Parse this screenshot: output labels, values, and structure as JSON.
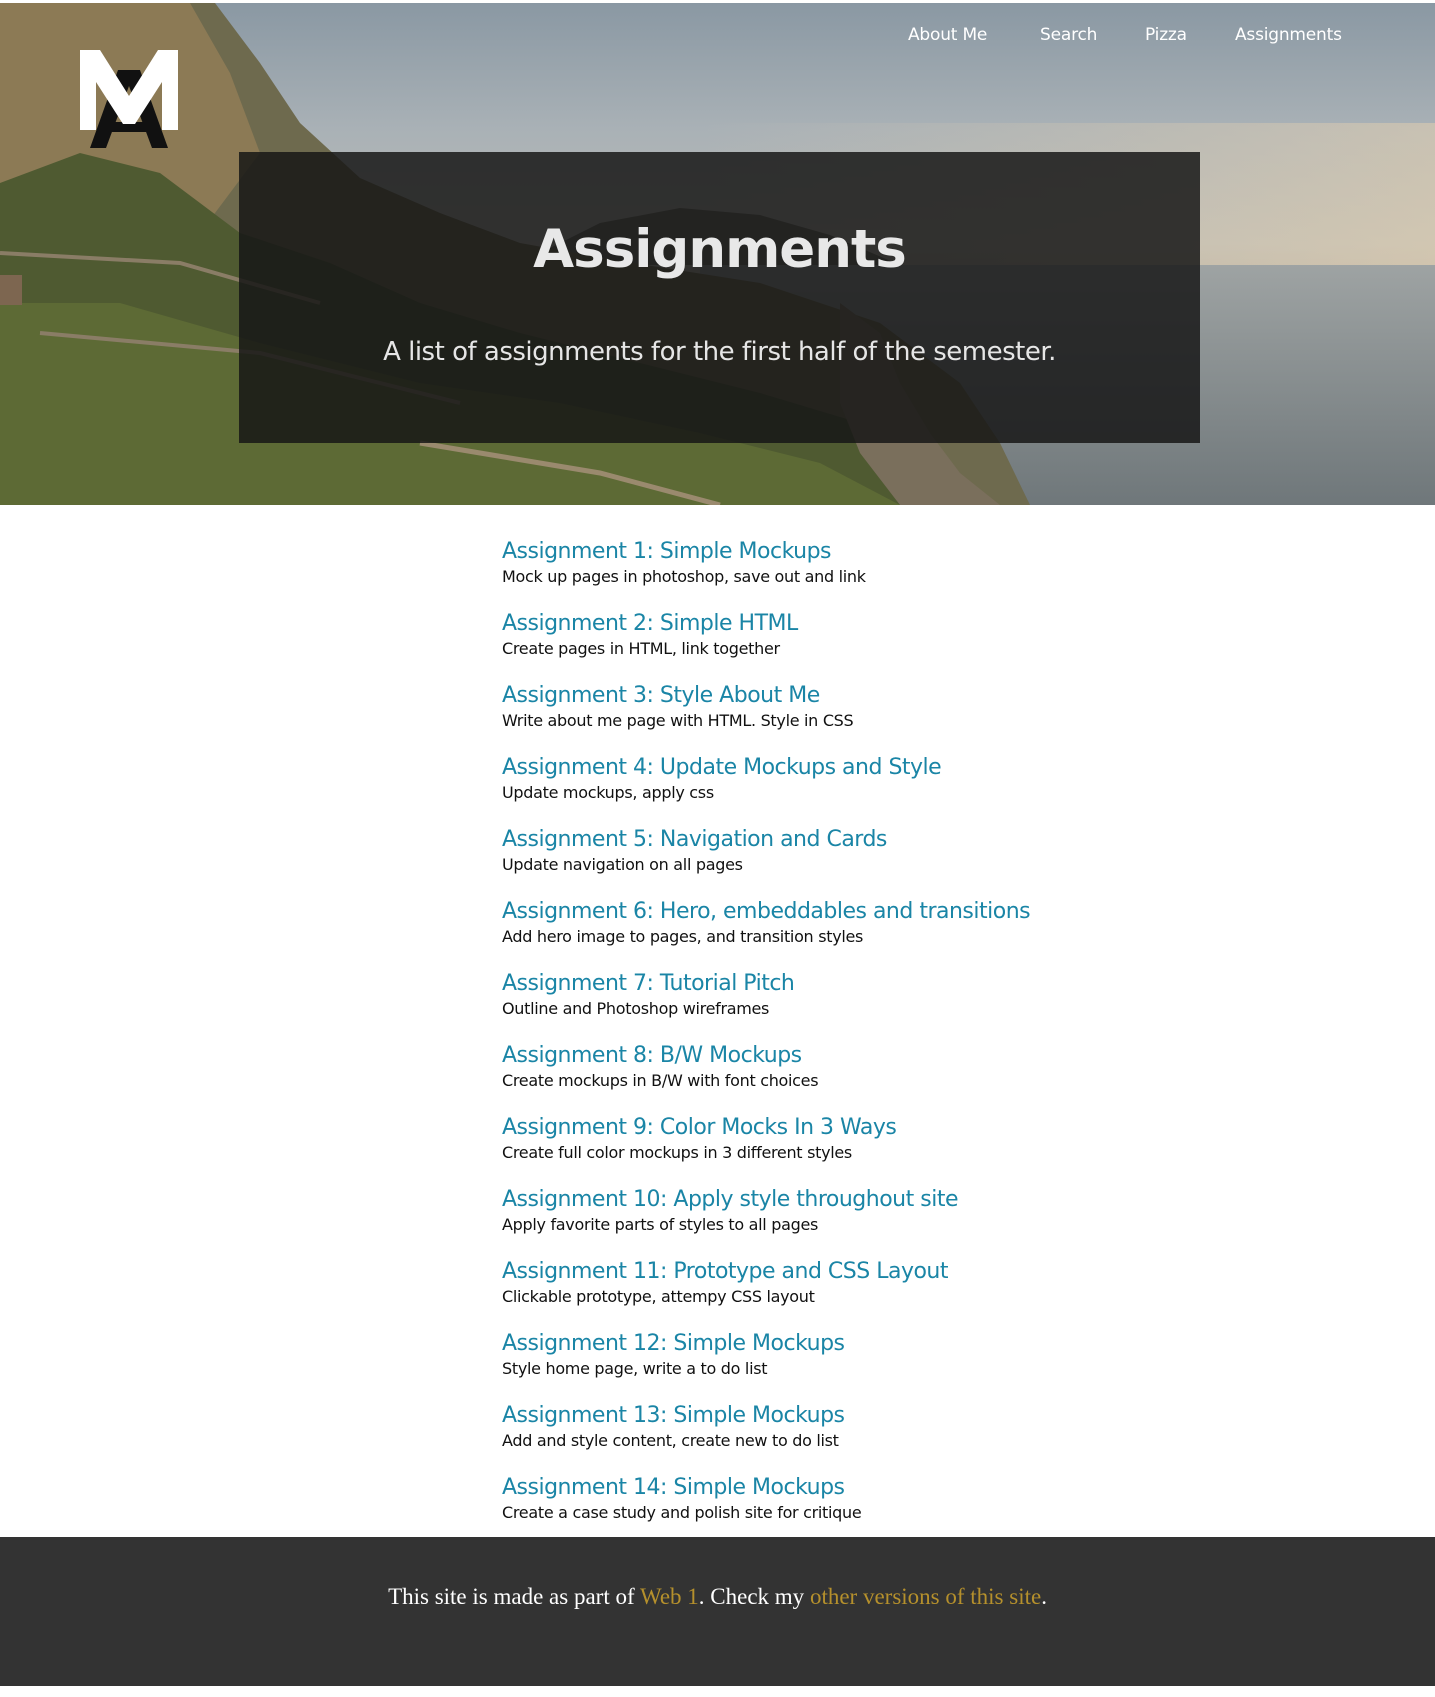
{
  "colors": {
    "link": "#1a85a6",
    "footer_bg": "#333333",
    "footer_link": "#b5902c",
    "hero_overlay": "#161616"
  },
  "logo": {
    "icon": "monogram-logo-icon",
    "letters": "MA"
  },
  "nav": {
    "items": [
      {
        "label": "About Me"
      },
      {
        "label": "Search"
      },
      {
        "label": "Pizza"
      },
      {
        "label": "Assignments"
      }
    ]
  },
  "hero": {
    "title": "Assignments",
    "subtitle": "A list of assignments for the first half of the semester."
  },
  "assignments": [
    {
      "title": "Assignment 1: Simple Mockups",
      "description": "Mock up pages in photoshop, save out and link"
    },
    {
      "title": "Assignment 2: Simple HTML",
      "description": "Create pages in HTML, link together"
    },
    {
      "title": "Assignment 3: Style About Me",
      "description": "Write about me page with HTML. Style in CSS"
    },
    {
      "title": "Assignment 4: Update Mockups and Style",
      "description": "Update mockups, apply css"
    },
    {
      "title": "Assignment 5: Navigation and Cards",
      "description": "Update navigation on all pages"
    },
    {
      "title": "Assignment 6: Hero, embeddables and transitions",
      "description": "Add hero image to pages, and transition styles"
    },
    {
      "title": "Assignment 7: Tutorial Pitch",
      "description": "Outline and Photoshop wireframes"
    },
    {
      "title": "Assignment 8: B/W Mockups",
      "description": "Create mockups in B/W with font choices"
    },
    {
      "title": "Assignment 9: Color Mocks In 3 Ways",
      "description": "Create full color mockups in 3 different styles"
    },
    {
      "title": "Assignment 10: Apply style throughout site",
      "description": "Apply favorite parts of styles to all pages"
    },
    {
      "title": "Assignment 11: Prototype and CSS Layout",
      "description": "Clickable prototype, attempy CSS layout"
    },
    {
      "title": "Assignment 12: Simple Mockups",
      "description": "Style home page, write a to do list"
    },
    {
      "title": "Assignment 13: Simple Mockups",
      "description": "Add and style content, create new to do list"
    },
    {
      "title": "Assignment 14: Simple Mockups",
      "description": "Create a case study and polish site for critique"
    }
  ],
  "footer": {
    "text_before": "This site is made as part of ",
    "link1": "Web 1",
    "text_middle": ". Check my ",
    "link2": "other versions of this site",
    "text_after": "."
  }
}
